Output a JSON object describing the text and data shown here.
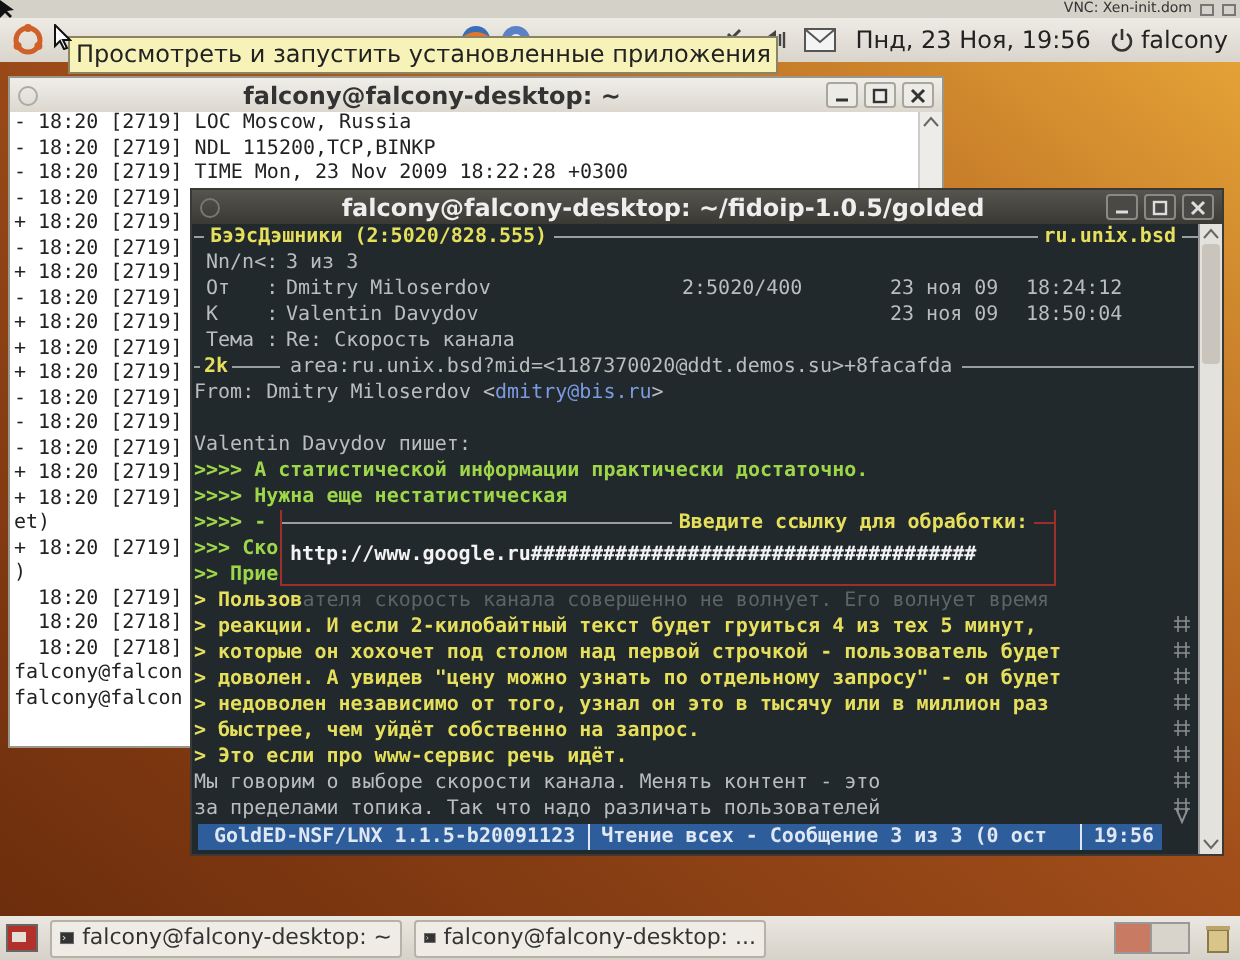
{
  "vnc_bar": {
    "title": "VNC: Xen-init.dom"
  },
  "top_panel": {
    "tooltip": "Просмотреть и запустить установленные приложения",
    "clock": "Пнд, 23 Ноя, 19:56",
    "user": "falcony"
  },
  "terminal_window": {
    "title": "falcony@falcony-desktop: ~",
    "lines": [
      "- 18:20 [2719] LOC Moscow, Russia",
      "- 18:20 [2719] NDL 115200,TCP,BINKP",
      "- 18:20 [2719] TIME Mon, 23 Nov 2009 18:22:28 +0300",
      "- 18:20 [2719]",
      "+ 18:20 [2719]",
      "- 18:20 [2719]",
      "+ 18:20 [2719]",
      "- 18:20 [2719]",
      "+ 18:20 [2719]",
      "+ 18:20 [2719]",
      "+ 18:20 [2719]",
      "- 18:20 [2719]",
      "- 18:20 [2719]",
      "- 18:20 [2719]",
      "+ 18:20 [2719]",
      "+ 18:20 [2719]",
      "et)",
      "+ 18:20 [2719]",
      ")",
      "  18:20 [2719]",
      "  18:20 [2718]",
      "  18:20 [2718]",
      "falcony@falcon",
      "falcony@falcon"
    ]
  },
  "golded_window": {
    "title": "falcony@falcony-desktop: ~/fidoip-1.0.5/golded",
    "area": "БэЭсДэшники (2:5020/828.555)",
    "echo": "ru.unix.bsd",
    "msg_header": [
      {
        "label": "Nn/n<:",
        "value": "3 из 3"
      },
      {
        "label": "От   :",
        "value": "Dmitry Miloserdov",
        "address": "2:5020/400",
        "date": "23 ноя 09",
        "time": "18:24:12"
      },
      {
        "label": "К    :",
        "value": "Valentin Davydov",
        "date": "23 ноя 09",
        "time": "18:50:04"
      },
      {
        "label": "Тема :",
        "value": "Re: Скорость канала"
      }
    ],
    "kludge": {
      "size": "2k",
      "text": "area:ru.unix.bsd?mid=<1187370020@ddt.demos.su>+8facafda"
    },
    "from_line": {
      "prefix": "From: Dmitry Miloserdov <",
      "email": "dmitry@bis.ru",
      "suffix": ">"
    },
    "body": [
      {
        "kind": "plain",
        "text": "Valentin Davydov пишет:"
      },
      {
        "kind": "quote_green",
        "text": ">>>> А статистической информации практически достаточно."
      },
      {
        "kind": "quote_green",
        "text": ">>>> Нужна еще нестатистическая"
      },
      {
        "kind": "quote_green",
        "text": ">>>> -"
      },
      {
        "kind": "quote_green",
        "text": ">>> Ско"
      },
      {
        "kind": "quote_green",
        "text": ">> Прие"
      },
      {
        "kind": "quote_yellow",
        "text": "> Пользов",
        "dim_text": "ателя скорость канала совершенно не волнует. Его волнует время"
      },
      {
        "kind": "quote_yellow",
        "text": "> реакции. И если 2-килобайтный текст будет груиться 4 из тех 5 минут,"
      },
      {
        "kind": "quote_yellow",
        "text": "> которые он хохочет под столом над первой строчкой - пользователь будет"
      },
      {
        "kind": "quote_yellow",
        "text": "> доволен. А увидев \"цену можно узнать по отдельному запросу\" - он будет"
      },
      {
        "kind": "quote_yellow",
        "text": "> недоволен независимо от того, узнал он это в тысячу или в миллион раз"
      },
      {
        "kind": "quote_yellow",
        "text": "> быстрее, чем уйдёт собственно на запрос."
      },
      {
        "kind": "quote_yellow",
        "text": "> Это если про www-сервис речь идёт."
      },
      {
        "kind": "plain",
        "text": "Мы говорим о выборе скорости канала. Менять контент - это"
      },
      {
        "kind": "plain",
        "text": "за пределами топика. Так что надо различать пользователей"
      }
    ],
    "dialog": {
      "title": "Введите ссылку для обработки:",
      "value": "http://www.google.ru#####################################"
    },
    "status_bar": [
      "GoldED-NSF/LNX 1.1.5-b20091123",
      "Чтение всех - Сообщение 3 из 3 (0 ост",
      "19:56"
    ]
  },
  "taskbar": {
    "tasks": [
      "falcony@falcony-desktop: ~",
      "falcony@falcony-desktop: ..."
    ]
  }
}
